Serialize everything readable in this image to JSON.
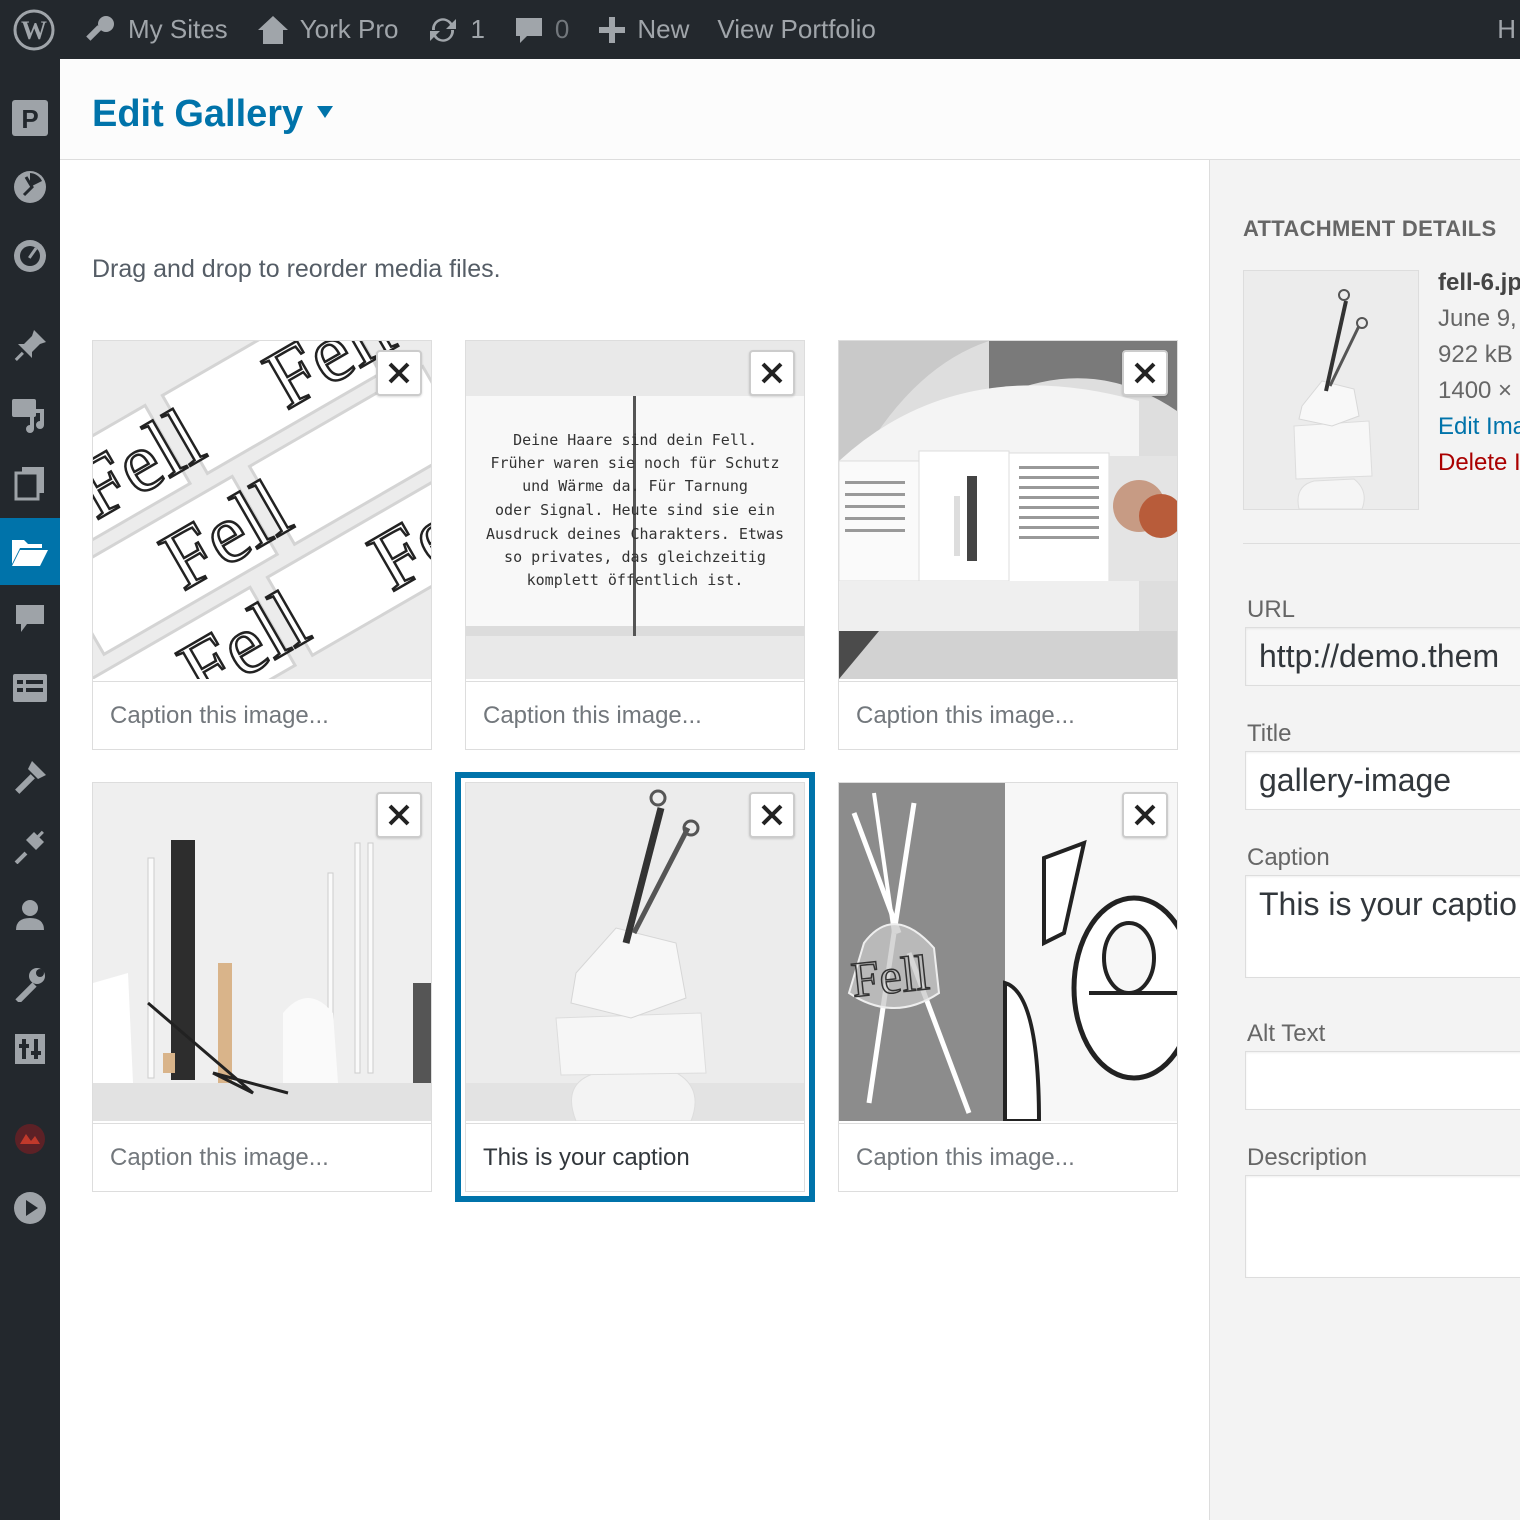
{
  "admin_bar": {
    "wp_logo_icon": "wordpress-logo-icon",
    "my_sites": "My Sites",
    "site_name": "York Pro",
    "updates_count": "1",
    "comments_count": "0",
    "new_label": "New",
    "view_label": "View Portfolio",
    "right_cut_label": "H"
  },
  "admin_menu": {
    "icons": [
      "pinterest-square-icon",
      "pie-chart-icon",
      "dashboard-icon",
      "pin-icon",
      "media-icon",
      "pages-icon",
      "folder-open-icon",
      "comments-icon",
      "list-view-icon",
      "appearance-icon",
      "plugins-icon",
      "users-icon",
      "tools-icon",
      "settings-icon",
      "plugin-badge-icon",
      "play-icon"
    ],
    "current_index": 6
  },
  "modal": {
    "title": "Edit Gallery",
    "instructions": "Drag and drop to reorder media files."
  },
  "gallery": {
    "caption_placeholder": "Caption this image...",
    "tiles": [
      {
        "image": "fell-lettering-pattern",
        "caption": ""
      },
      {
        "image": "fell-text-book-spread",
        "caption": ""
      },
      {
        "image": "fell-magazine-spread",
        "caption": ""
      },
      {
        "image": "fell-studio-still-life",
        "caption": ""
      },
      {
        "image": "scissors-on-stones",
        "caption": "This is your caption",
        "selected": true
      },
      {
        "image": "fell-plastic-bag",
        "caption": ""
      }
    ],
    "book_text_lines": [
      "Deine Haare sind dein Fell.",
      "Früher waren sie noch für Schutz",
      "und Wärme da. Für Tarnung",
      "oder Signal. Heute sind sie ein",
      "Ausdruck deines Charakters. Etwas",
      "so privates, das gleichzeitig",
      "komplett öffentlich ist."
    ],
    "lettering_word": "Fell"
  },
  "sidebar": {
    "heading": "ATTACHMENT DETAILS",
    "filename": "fell-6.jp",
    "date": "June 9, ",
    "filesize": "922 kB",
    "dimensions": "1400 ×",
    "edit_link": "Edit Ima",
    "delete_link": "Delete I",
    "url_label": "URL",
    "url_value": "http://demo.them",
    "title_label": "Title",
    "title_value": "gallery-image",
    "caption_label": "Caption",
    "caption_value": "This is your captio",
    "alt_label": "Alt Text",
    "alt_value": "",
    "description_label": "Description",
    "description_value": ""
  },
  "colors": {
    "accent": "#0073aa",
    "admin_bar": "#23282d",
    "delete": "#aa0000"
  }
}
